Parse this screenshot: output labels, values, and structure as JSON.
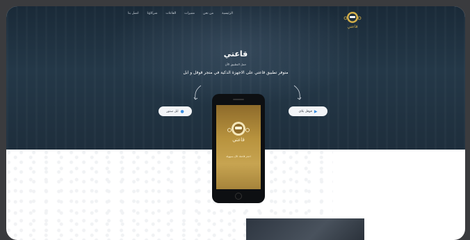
{
  "nav": {
    "items": [
      "الرئيسية",
      "من نحن",
      "مميزات",
      "القاعات",
      "شركاؤنا",
      "اتصل بنا"
    ]
  },
  "logo": {
    "text": "قاعتي"
  },
  "hero": {
    "title": "قاعتي",
    "subtitle": "حمل التطبيق الآن",
    "description": "متوفر تطبيق قاعتي على الاجهزة الذكية في متجر قوقل و ابل"
  },
  "buttons": {
    "apple": {
      "label": "ابل ستور",
      "icon": "apple-icon"
    },
    "google": {
      "label": "قوقل بلاي",
      "icon": "google-play-icon"
    }
  },
  "phone": {
    "app_name": "قاعتي",
    "tagline": "احجز قاعتك الآن بسهولة"
  },
  "colors": {
    "hero_bg": "#1e2e3c",
    "button_bg": "#f2f4f7",
    "accent": "#3a8ddf",
    "gold": "#c7a451"
  }
}
